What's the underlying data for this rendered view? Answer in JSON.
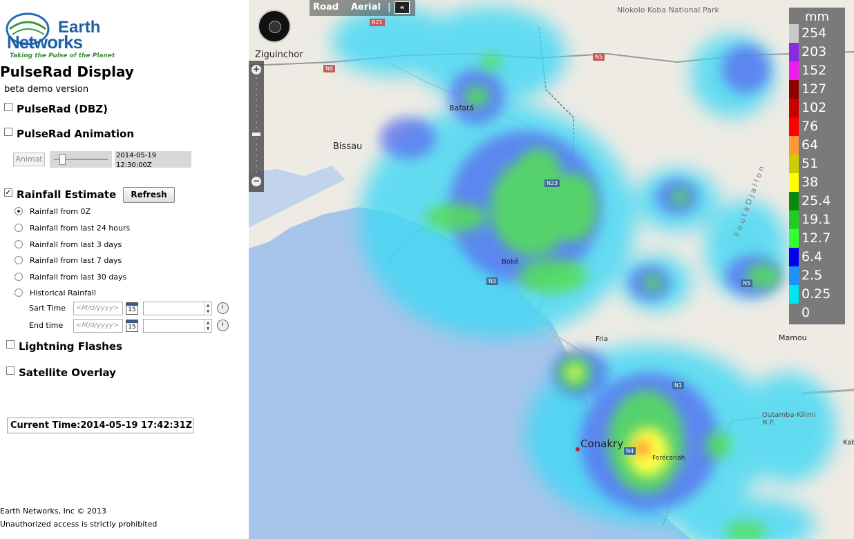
{
  "logo": {
    "line1": "Earth",
    "line2": "Networks",
    "tagline": "Taking the Pulse of the Planet"
  },
  "title": "PulseRad Display",
  "subtitle": "beta demo version",
  "layers": {
    "pulserad_dbz": "PulseRad (DBZ)",
    "pulserad_animation": "PulseRad Animation",
    "rainfall_estimate": "Rainfall Estimate",
    "lightning": "Lightning Flashes",
    "satellite": "Satellite Overlay"
  },
  "animation": {
    "button": "Animat",
    "timestamp": "2014-05-19 12:30:00Z",
    "slider_position": 0.1
  },
  "rainfall": {
    "refresh": "Refresh",
    "options": [
      "Rainfall from 0Z",
      "Rainfall from last 24 hours",
      "Rainfall from last 3 days",
      "Rainfall from last 7 days",
      "Rainfall from last 30 days",
      "Historical Rainfall"
    ],
    "selected": "Rainfall from 0Z",
    "start_label": "Sart Time",
    "end_label": "End time",
    "date_placeholder": "<M/d/yyyy>",
    "calendar_day": "15"
  },
  "current_time": "Current Time:2014-05-19 17:42:31Z",
  "footer": {
    "copyright": "Earth Networks, Inc © 2013",
    "warning": "Unauthorized access is strictly prohibited"
  },
  "map": {
    "road": "Road",
    "aerial": "Aerial",
    "collapse": "«",
    "places": {
      "ziguinchor": "Ziguinchor",
      "bafata": "Bafatá",
      "bissau": "Bissau",
      "boke": "Boké",
      "fria": "Fria",
      "conakry": "Conakry",
      "forecariah": "Forécariah",
      "mamou": "Mamou",
      "park_niokolo": "Niokolo Koba National Park",
      "park_outamba": "Outamba-Kilimi N.P.",
      "kab": "Kab",
      "fouta": "F o u t a   D j a l l o n"
    },
    "roads": {
      "r21": "R21",
      "n6": "N6",
      "n5a": "N5",
      "n5b": "N5",
      "n23": "N23",
      "n3": "N3",
      "n1": "N1",
      "n4": "N4"
    }
  },
  "legend": {
    "unit": "mm",
    "rows": [
      {
        "value": "254",
        "color": "#c8c8c8"
      },
      {
        "value": "203",
        "color": "#8a2be2"
      },
      {
        "value": "152",
        "color": "#ee1bee"
      },
      {
        "value": "127",
        "color": "#8b0000"
      },
      {
        "value": "102",
        "color": "#c80000"
      },
      {
        "value": "76",
        "color": "#ff0000"
      },
      {
        "value": "64",
        "color": "#ff9933"
      },
      {
        "value": "51",
        "color": "#cccc00"
      },
      {
        "value": "38",
        "color": "#ffff00"
      },
      {
        "value": "25.4",
        "color": "#0a8a0a"
      },
      {
        "value": "19.1",
        "color": "#22cc22"
      },
      {
        "value": "12.7",
        "color": "#33ff33"
      },
      {
        "value": "6.4",
        "color": "#0000ee"
      },
      {
        "value": "2.5",
        "color": "#1e90ff"
      },
      {
        "value": "0.25",
        "color": "#00e5ee"
      },
      {
        "value": "0",
        "color": "#7a7a7a"
      }
    ]
  }
}
